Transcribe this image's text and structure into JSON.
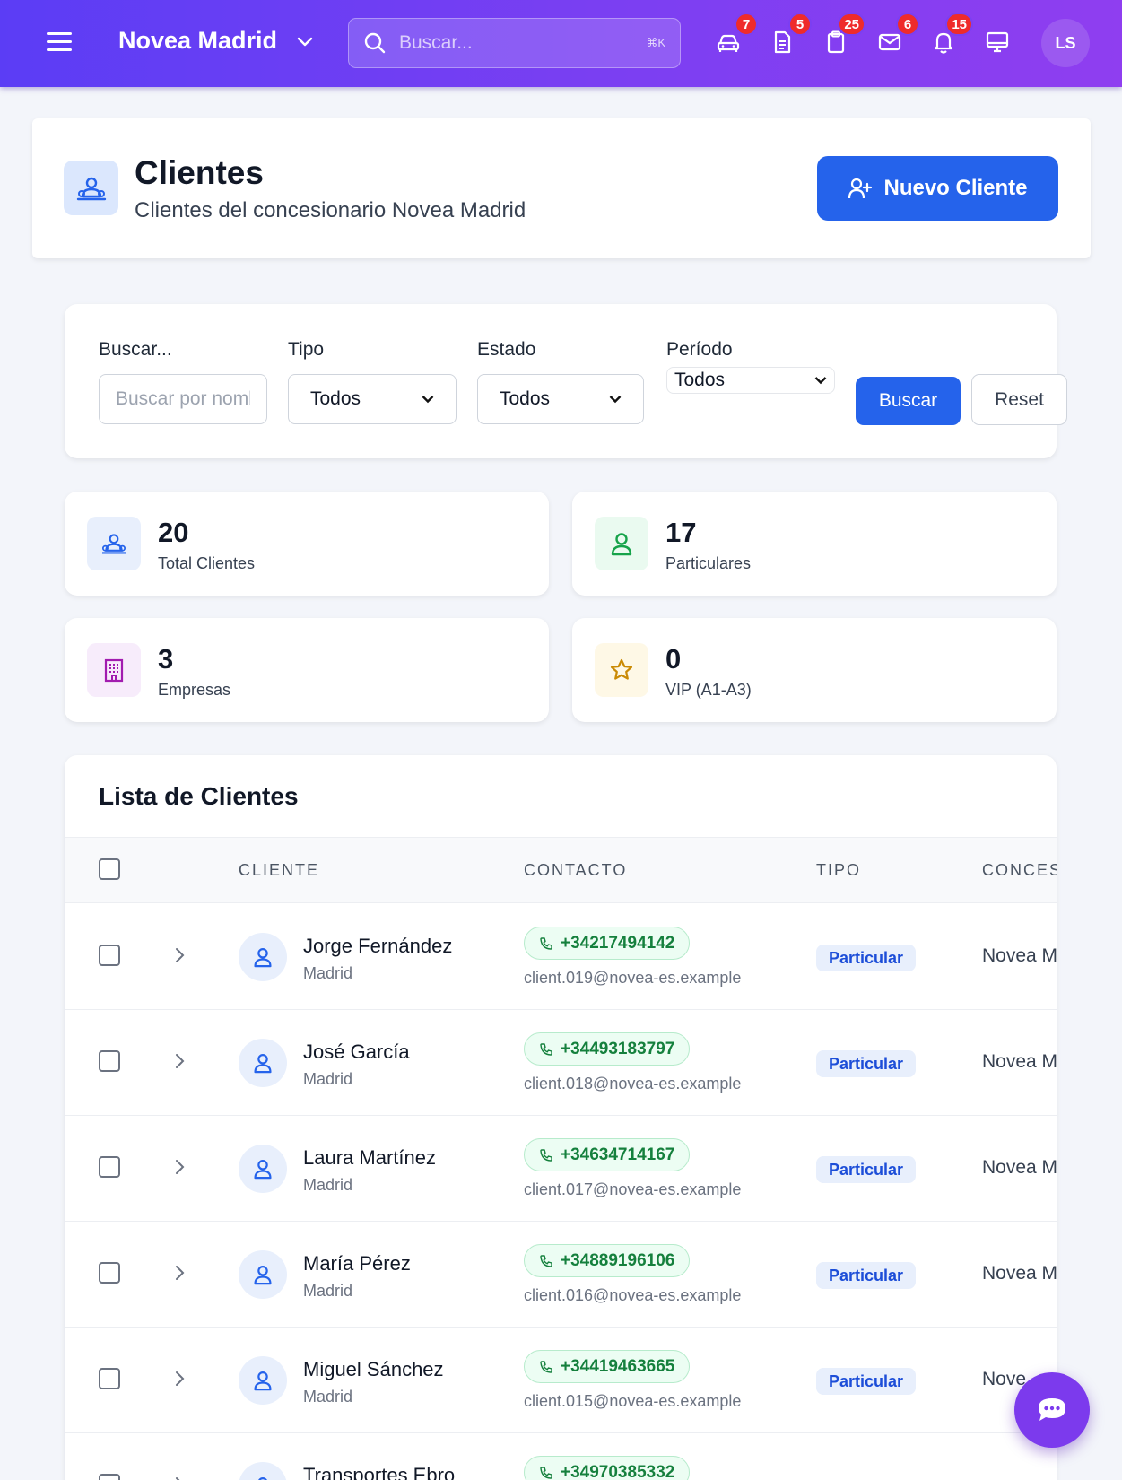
{
  "topbar": {
    "brand": "Novea Madrid",
    "search_placeholder": "Buscar...",
    "search_shortcut": "⌘K",
    "icons": [
      {
        "name": "car-icon",
        "badge": "7"
      },
      {
        "name": "document-icon",
        "badge": "5"
      },
      {
        "name": "clipboard-icon",
        "badge": "25"
      },
      {
        "name": "mail-icon",
        "badge": "6"
      },
      {
        "name": "bell-icon",
        "badge": "15"
      },
      {
        "name": "monitor-icon",
        "badge": ""
      }
    ],
    "user_initials": "LS"
  },
  "header": {
    "title": "Clientes",
    "subtitle": "Clientes del concesionario Novea Madrid",
    "new_button": "Nuevo Cliente"
  },
  "filters": {
    "search_label": "Buscar...",
    "search_placeholder": "Buscar por nombre",
    "tipo_label": "Tipo",
    "tipo_value": "Todos",
    "estado_label": "Estado",
    "estado_value": "Todos",
    "periodo_label": "Período",
    "periodo_value": "Todos",
    "search_button": "Buscar",
    "reset_button": "Reset"
  },
  "stats": [
    {
      "value": "20",
      "label": "Total Clientes",
      "color": "#2563eb",
      "bg": "#e8effc",
      "icon": "users-icon"
    },
    {
      "value": "17",
      "label": "Particulares",
      "color": "#16a34a",
      "bg": "#eafaf0",
      "icon": "user-icon"
    },
    {
      "value": "3",
      "label": "Empresas",
      "color": "#a21caf",
      "bg": "#f7ecfb",
      "icon": "building-icon"
    },
    {
      "value": "0",
      "label": "VIP (A1-A3)",
      "color": "#ca8a04",
      "bg": "#fef8e6",
      "icon": "star-icon"
    }
  ],
  "table": {
    "title": "Lista de Clientes",
    "columns": [
      "CLIENTE",
      "CONTACTO",
      "TIPO",
      "CONCES"
    ],
    "rows": [
      {
        "name": "Jorge Fernández",
        "city": "Madrid",
        "phone": "+34217494142",
        "email": "client.019@novea-es.example",
        "tipo": "Particular",
        "conces": "Novea M"
      },
      {
        "name": "José García",
        "city": "Madrid",
        "phone": "+34493183797",
        "email": "client.018@novea-es.example",
        "tipo": "Particular",
        "conces": "Novea M"
      },
      {
        "name": "Laura Martínez",
        "city": "Madrid",
        "phone": "+34634714167",
        "email": "client.017@novea-es.example",
        "tipo": "Particular",
        "conces": "Novea M"
      },
      {
        "name": "María Pérez",
        "city": "Madrid",
        "phone": "+34889196106",
        "email": "client.016@novea-es.example",
        "tipo": "Particular",
        "conces": "Novea M"
      },
      {
        "name": "Miguel Sánchez",
        "city": "Madrid",
        "phone": "+34419463665",
        "email": "client.015@novea-es.example",
        "tipo": "Particular",
        "conces": "Nove"
      },
      {
        "name": "Transportes Ebro",
        "city": "",
        "phone": "+34970385332",
        "email": "",
        "tipo": "",
        "conces": ""
      }
    ]
  }
}
